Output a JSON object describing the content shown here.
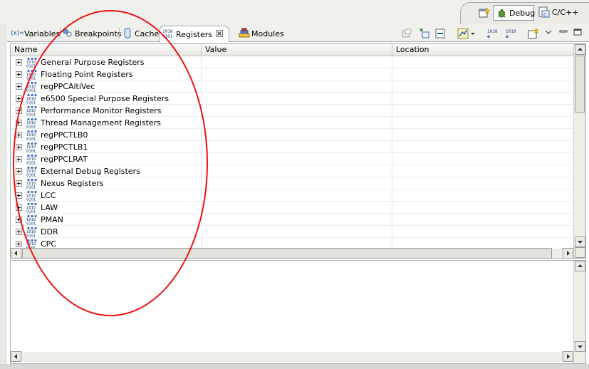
{
  "perspectives": {
    "debug_label": "Debug",
    "cc_label": "C/C++"
  },
  "tabs": [
    {
      "label": "Variables",
      "icon": "variables-icon"
    },
    {
      "label": "Breakpoints",
      "icon": "breakpoints-icon"
    },
    {
      "label": "Cache",
      "icon": "cache-icon"
    },
    {
      "label": "Registers",
      "icon": "registers-icon",
      "active": true
    },
    {
      "label": "Modules",
      "icon": "modules-icon"
    }
  ],
  "table": {
    "columns": [
      "Name",
      "Value",
      "Location"
    ],
    "rows": [
      "General Purpose Registers",
      "Floating Point Registers",
      "regPPCAltiVec",
      "e6500 Special Purpose Registers",
      "Performance Monitor Registers",
      "Thread Management Registers",
      "regPPCTLB0",
      "regPPCTLB1",
      "regPPCLRAT",
      "External Debug Registers",
      "Nexus Registers",
      "LCC",
      "LAW",
      "PMAN",
      "DDR",
      "CPC"
    ]
  },
  "colors": {
    "annotation": "#ee1111",
    "accent": "#2a5db0"
  }
}
